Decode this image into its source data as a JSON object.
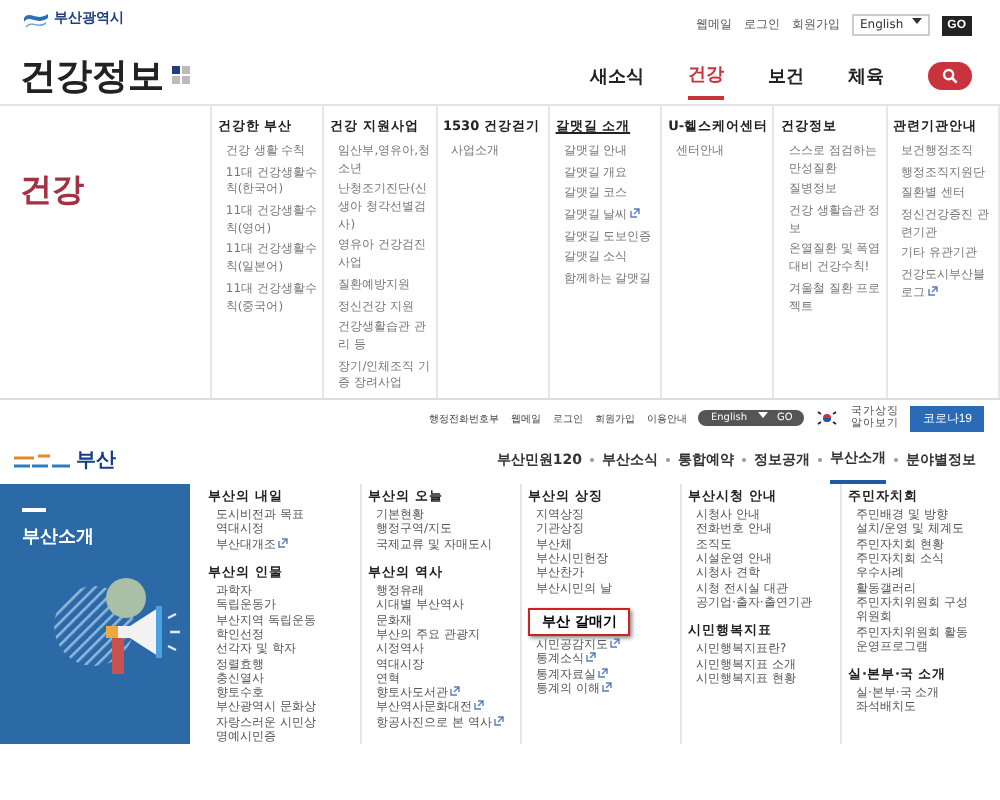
{
  "site_header": {
    "logo": "부산광역시",
    "links": [
      "웹메일",
      "로그인",
      "회원가입"
    ],
    "language": "English",
    "go": "GO"
  },
  "section_header": {
    "title": "건강정보",
    "nav": [
      {
        "label": "새소식",
        "selected": false
      },
      {
        "label": "건강",
        "selected": true
      },
      {
        "label": "보건",
        "selected": false
      },
      {
        "label": "체육",
        "selected": false
      }
    ]
  },
  "mega_menu": {
    "heading": "건강",
    "columns": [
      {
        "title": "건강한 부산",
        "selected": false,
        "items": [
          {
            "label": "건강 생활 수칙",
            "external": false
          },
          {
            "label": "11대 건강생활수칙(한국어)",
            "external": false
          },
          {
            "label": "11대 건강생활수칙(영어)",
            "external": false
          },
          {
            "label": "11대 건강생활수칙(일본어)",
            "external": false
          },
          {
            "label": "11대 건강생활수칙(중국어)",
            "external": false
          }
        ]
      },
      {
        "title": "건강 지원사업",
        "selected": false,
        "items": [
          {
            "label": "임산부,영유아,청소년",
            "external": false
          },
          {
            "label": "난청조기진단(신생아 청각선별검사)",
            "external": false
          },
          {
            "label": "영유아 건강검진 사업",
            "external": false
          },
          {
            "label": "질환예방지원",
            "external": false
          },
          {
            "label": "정신건강 지원",
            "external": false
          },
          {
            "label": "건강생활습관 관리 등",
            "external": false
          },
          {
            "label": "장기/인체조직 기증 장려사업",
            "external": false
          }
        ]
      },
      {
        "title": "1530 건강걷기",
        "selected": false,
        "items": [
          {
            "label": "사업소개",
            "external": false
          }
        ]
      },
      {
        "title": "갈맷길 소개",
        "selected": true,
        "items": [
          {
            "label": "갈맷길 안내",
            "external": false
          },
          {
            "label": "갈맷길 개요",
            "external": false
          },
          {
            "label": "갈맷길 코스",
            "external": false
          },
          {
            "label": "갈맷길 날씨",
            "external": true
          },
          {
            "label": "갈맷길 도보인증",
            "external": false
          },
          {
            "label": "갈맷길 소식",
            "external": false
          },
          {
            "label": "함께하는 갈맷길",
            "external": false
          }
        ]
      },
      {
        "title": "U-헬스케어센터",
        "selected": false,
        "items": [
          {
            "label": "센터안내",
            "external": false
          }
        ]
      },
      {
        "title": "건강정보",
        "selected": false,
        "items": [
          {
            "label": "스스로 점검하는 만성질환",
            "external": false
          },
          {
            "label": "질병정보",
            "external": false
          },
          {
            "label": "건강 생활습관 정보",
            "external": false
          },
          {
            "label": "온열질환 및 폭염대비 건강수칙!",
            "external": false
          },
          {
            "label": "겨울철 질환 프로젝트",
            "external": false
          }
        ]
      },
      {
        "title": "관련기관안내",
        "selected": false,
        "items": [
          {
            "label": "보건행정조직",
            "external": false
          },
          {
            "label": "행정조직지원단",
            "external": false
          },
          {
            "label": "질환별 센터",
            "external": false
          },
          {
            "label": "정신건강증진 관련기관",
            "external": false
          },
          {
            "label": "기타 유관기관",
            "external": false
          },
          {
            "label": "건강도시부산블로그",
            "external": true
          }
        ]
      }
    ]
  },
  "portal": {
    "links": [
      "행정전화번호부",
      "웹메일",
      "로그인",
      "회원가입",
      "이용안내"
    ],
    "language": "English",
    "go": "GO",
    "national_symbol": "국가상징 알아보기",
    "covid_button": "코로나19",
    "logo": "부산",
    "nav": [
      {
        "label": "부산민원120",
        "selected": false
      },
      {
        "label": "부산소식",
        "selected": false
      },
      {
        "label": "통합예약",
        "selected": false
      },
      {
        "label": "정보공개",
        "selected": false
      },
      {
        "label": "부산소개",
        "selected": true
      },
      {
        "label": "분야별정보",
        "selected": false
      }
    ],
    "panel_title": "부산소개",
    "columns": [
      {
        "groups": [
          {
            "title": "부산의 내일",
            "highlighted": false,
            "items": [
              {
                "label": "도시비전과 목표",
                "external": false
              },
              {
                "label": "역대시정",
                "external": false
              },
              {
                "label": "부산대개조",
                "external": true
              }
            ]
          },
          {
            "title": "부산의 인물",
            "highlighted": false,
            "items": [
              {
                "label": "과학자",
                "external": false
              },
              {
                "label": "독립운동가",
                "external": false
              },
              {
                "label": "부산지역 독립운동",
                "external": false
              },
              {
                "label": "학인선정",
                "external": false
              },
              {
                "label": "선각자 및 학자",
                "external": false
              },
              {
                "label": "정렬효행",
                "external": false
              },
              {
                "label": "충신열사",
                "external": false
              },
              {
                "label": "향토수호",
                "external": false
              },
              {
                "label": "부산광역시 문화상",
                "external": false
              },
              {
                "label": "자랑스러운 시민상",
                "external": false
              },
              {
                "label": "명예시민증",
                "external": false
              }
            ]
          }
        ]
      },
      {
        "groups": [
          {
            "title": "부산의 오늘",
            "highlighted": false,
            "items": [
              {
                "label": "기본현황",
                "external": false
              },
              {
                "label": "행정구역/지도",
                "external": false
              },
              {
                "label": "국제교류 및 자매도시",
                "external": false
              }
            ]
          },
          {
            "title": "부산의 역사",
            "highlighted": false,
            "items": [
              {
                "label": "행정유래",
                "external": false
              },
              {
                "label": "시대별 부산역사",
                "external": false
              },
              {
                "label": "문화재",
                "external": false
              },
              {
                "label": "부산의 주요 관광지",
                "external": false
              },
              {
                "label": "시정역사",
                "external": false
              },
              {
                "label": "역대시장",
                "external": false
              },
              {
                "label": "연혁",
                "external": false
              },
              {
                "label": "향토사도서관",
                "external": true
              },
              {
                "label": "부산역사문화대전",
                "external": true
              },
              {
                "label": "항공사진으로 본 역사",
                "external": true
              }
            ]
          }
        ]
      },
      {
        "groups": [
          {
            "title": "부산의 상징",
            "highlighted": false,
            "items": [
              {
                "label": "지역상징",
                "external": false
              },
              {
                "label": "기관상징",
                "external": false
              },
              {
                "label": "부산체",
                "external": false
              },
              {
                "label": "부산시민헌장",
                "external": false
              },
              {
                "label": "부산찬가",
                "external": false
              },
              {
                "label": "부산시민의 날",
                "external": false
              }
            ]
          },
          {
            "title": "부산 갈매기",
            "highlighted": true,
            "items": [
              {
                "label": "시민공감지도",
                "external": true
              },
              {
                "label": "통계소식",
                "external": true
              },
              {
                "label": "통계자료실",
                "external": true
              },
              {
                "label": "통계의 이해",
                "external": true
              }
            ]
          }
        ]
      },
      {
        "groups": [
          {
            "title": "부산시청 안내",
            "highlighted": false,
            "items": [
              {
                "label": "시청사 안내",
                "external": false
              },
              {
                "label": "전화번호 안내",
                "external": false
              },
              {
                "label": "조직도",
                "external": false
              },
              {
                "label": "시설운영 안내",
                "external": false
              },
              {
                "label": "시청사 견학",
                "external": false
              },
              {
                "label": "시청 전시실 대관",
                "external": false
              },
              {
                "label": "공기업·출자·출연기관",
                "external": false
              }
            ]
          },
          {
            "title": "시민행복지표",
            "highlighted": false,
            "items": [
              {
                "label": "시민행복지표란?",
                "external": false
              },
              {
                "label": "시민행복지표 소개",
                "external": false
              },
              {
                "label": "시민행복지표 현황",
                "external": false
              }
            ]
          }
        ]
      },
      {
        "groups": [
          {
            "title": "주민자치회",
            "highlighted": false,
            "items": [
              {
                "label": "주민배경 및 방향",
                "external": false
              },
              {
                "label": "설치/운영 및 체계도",
                "external": false
              },
              {
                "label": "주민자치회 현황",
                "external": false
              },
              {
                "label": "주민자치회 소식",
                "external": false
              },
              {
                "label": "우수사례",
                "external": false
              },
              {
                "label": "활동갤러리",
                "external": false
              },
              {
                "label": "주민자치위원회 구성",
                "external": false
              },
              {
                "label": "위원회",
                "external": false
              },
              {
                "label": "주민자치위원회 활동",
                "external": false
              },
              {
                "label": "운영프로그램",
                "external": false
              }
            ]
          },
          {
            "title": "실·본부·국 소개",
            "highlighted": false,
            "items": [
              {
                "label": "실·본부·국 소개",
                "external": false
              },
              {
                "label": "좌석배치도",
                "external": false
              }
            ]
          }
        ]
      }
    ]
  }
}
